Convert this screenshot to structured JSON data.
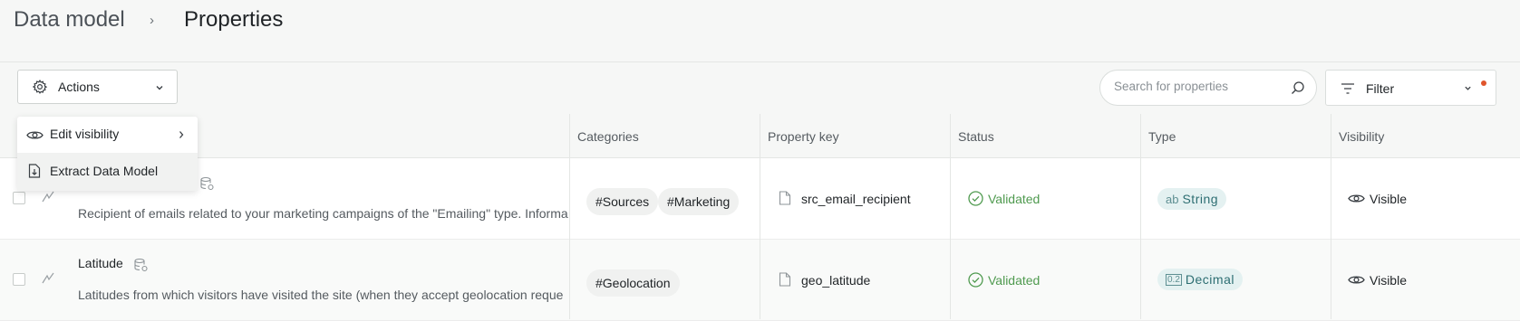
{
  "breadcrumb": {
    "root": "Data model",
    "separator": "›",
    "current": "Properties"
  },
  "toolbar": {
    "actions_label": "Actions",
    "search_placeholder": "Search for properties",
    "filter_label": "Filter"
  },
  "actions_menu": {
    "items": [
      {
        "label": "Edit visibility",
        "icon": "eye-icon",
        "has_submenu": true
      },
      {
        "label": "Extract Data Model",
        "icon": "document-download-icon",
        "has_submenu": false
      }
    ]
  },
  "table": {
    "columns": [
      "Categories",
      "Property key",
      "Status",
      "Type",
      "Visibility"
    ],
    "rows": [
      {
        "name": "",
        "description": "Recipient of emails related to your marketing campaigns of the \"Emailing\" type. Informa",
        "categories": [
          "#Sources",
          "#Marketing"
        ],
        "property_key": "src_email_recipient",
        "status": "Validated",
        "type_prefix": "ab",
        "type": "String",
        "visibility": "Visible"
      },
      {
        "name": "Latitude",
        "description": "Latitudes from which visitors have visited the site (when they accept geolocation reque",
        "categories": [
          "#Geolocation"
        ],
        "property_key": "geo_latitude",
        "status": "Validated",
        "type_prefix": "0.2",
        "type": "Decimal",
        "visibility": "Visible"
      }
    ]
  },
  "colors": {
    "status_green": "#4f9a4f",
    "type_chip_bg": "#e4f1f1",
    "type_chip_text": "#2d6e72",
    "filter_dot": "#e0552c"
  }
}
